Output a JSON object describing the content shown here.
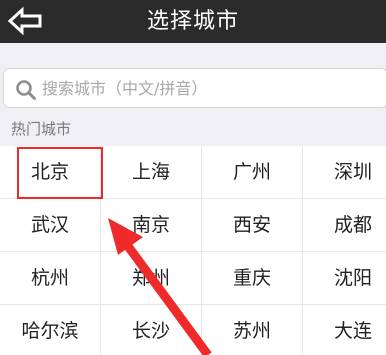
{
  "header": {
    "title": "选择城市",
    "back_icon": "back-arrow-icon"
  },
  "search": {
    "placeholder": "搜索城市（中文/拼音）",
    "icon": "search-icon"
  },
  "hot_cities": {
    "label": "热门城市",
    "rows": [
      [
        "北京",
        "上海",
        "广州",
        "深圳"
      ],
      [
        "武汉",
        "南京",
        "西安",
        "成都"
      ],
      [
        "杭州",
        "郑州",
        "重庆",
        "沈阳"
      ],
      [
        "哈尔滨",
        "长沙",
        "苏州",
        "大连"
      ]
    ]
  },
  "annotation": {
    "color": "#ee2a2a",
    "highlighted_city": "北京"
  }
}
